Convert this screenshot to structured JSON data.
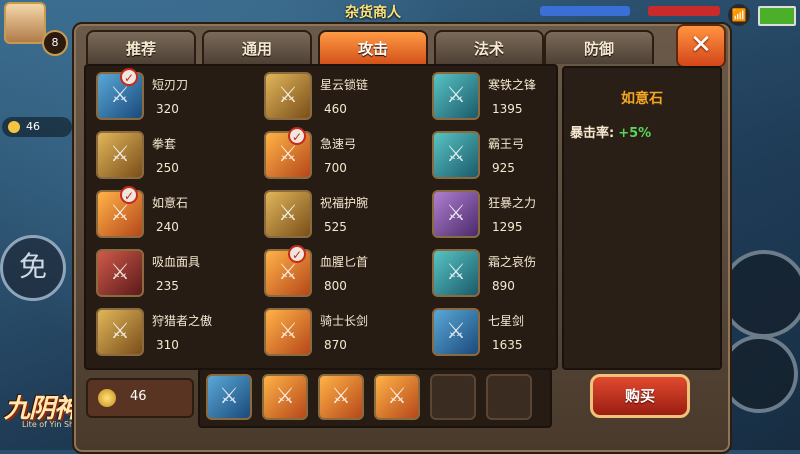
{
  "hud": {
    "npc_title": "杂货商人",
    "level": "8",
    "coins": "46",
    "avoid_label": "免",
    "wifi_icon": "wifi-icon",
    "logo_text": "九阴神功",
    "logo_sub": "Lite of Yin Shen"
  },
  "tabs": [
    {
      "label": "推荐",
      "active": false
    },
    {
      "label": "通用",
      "active": false
    },
    {
      "label": "攻击",
      "active": true
    },
    {
      "label": "法术",
      "active": false
    },
    {
      "label": "防御",
      "active": false
    }
  ],
  "close_label": "✕",
  "items": [
    {
      "name": "短刃刀",
      "price": "320",
      "checked": true,
      "art": "art-blue",
      "icon": "dagger-icon"
    },
    {
      "name": "星云锁链",
      "price": "460",
      "checked": false,
      "art": "art-gold",
      "icon": "chain-icon"
    },
    {
      "name": "寒铁之锋",
      "price": "1395",
      "checked": false,
      "art": "art-teal",
      "icon": "blade-icon"
    },
    {
      "name": "拳套",
      "price": "250",
      "checked": false,
      "art": "art-gold",
      "icon": "gauntlet-icon"
    },
    {
      "name": "急速弓",
      "price": "700",
      "checked": true,
      "art": "art-orange",
      "icon": "bow-icon"
    },
    {
      "name": "霸王弓",
      "price": "925",
      "checked": false,
      "art": "art-teal",
      "icon": "bow-icon"
    },
    {
      "name": "如意石",
      "price": "240",
      "checked": true,
      "art": "art-orange",
      "icon": "stone-icon"
    },
    {
      "name": "祝福护腕",
      "price": "525",
      "checked": false,
      "art": "art-gold",
      "icon": "bracer-icon"
    },
    {
      "name": "狂暴之力",
      "price": "1295",
      "checked": false,
      "art": "art-purple",
      "icon": "sword-icon"
    },
    {
      "name": "吸血面具",
      "price": "235",
      "checked": false,
      "art": "art-red",
      "icon": "mask-icon"
    },
    {
      "name": "血腥匕首",
      "price": "800",
      "checked": true,
      "art": "art-orange",
      "icon": "dagger-icon"
    },
    {
      "name": "霜之哀伤",
      "price": "890",
      "checked": false,
      "art": "art-teal",
      "icon": "sword-icon"
    },
    {
      "name": "狩猎者之傲",
      "price": "310",
      "checked": false,
      "art": "art-gold",
      "icon": "crossbow-icon"
    },
    {
      "name": "骑士长剑",
      "price": "870",
      "checked": false,
      "art": "art-orange",
      "icon": "sword-icon"
    },
    {
      "name": "七星剑",
      "price": "1635",
      "checked": false,
      "art": "art-blue",
      "icon": "sword-icon"
    }
  ],
  "detail": {
    "name": "如意石",
    "stat_label": "暴击率:",
    "stat_value": "+5%"
  },
  "gold": "46",
  "cart": [
    {
      "art": "art-blue",
      "icon": "dagger-icon",
      "empty": false
    },
    {
      "art": "art-orange",
      "icon": "bow-icon",
      "empty": false
    },
    {
      "art": "art-orange",
      "icon": "dagger-icon",
      "empty": false
    },
    {
      "art": "art-orange",
      "icon": "stone-icon",
      "empty": false
    },
    {
      "empty": true
    },
    {
      "empty": true
    }
  ],
  "buy_label": "购买"
}
